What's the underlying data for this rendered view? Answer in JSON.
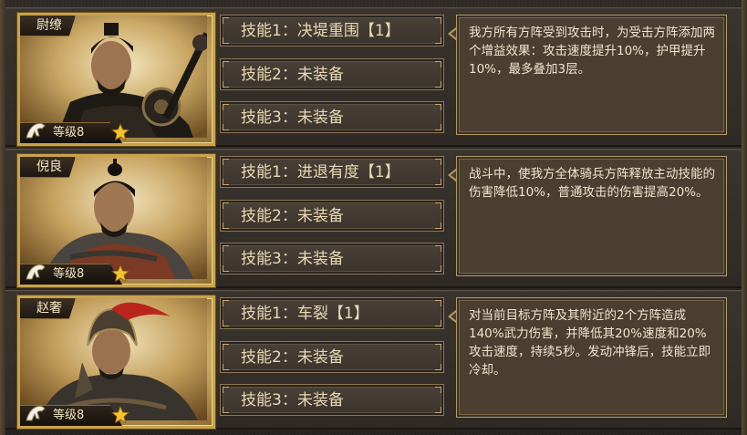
{
  "colors": {
    "gold_frame": "#c9a24a",
    "panel_bg": "#4a3f30",
    "text_light": "#efe6d0"
  },
  "generals": [
    {
      "name": "尉缭",
      "level": "等级8",
      "skills": [
        "技能1：决堤重围【1】",
        "技能2：未装备",
        "技能3：未装备"
      ],
      "description": "我方所有方阵受到攻击时，为受击方阵添加两个增益效果：攻击速度提升10%，护甲提升10%，最多叠加3层。"
    },
    {
      "name": "倪良",
      "level": "等级8",
      "skills": [
        "技能1：进退有度【1】",
        "技能2：未装备",
        "技能3：未装备"
      ],
      "description": "战斗中，使我方全体骑兵方阵释放主动技能的伤害降低10%，普通攻击的伤害提高20%。"
    },
    {
      "name": "赵奢",
      "level": "等级8",
      "skills": [
        "技能1：车裂【1】",
        "技能2：未装备",
        "技能3：未装备"
      ],
      "description": "对当前目标方阵及其附近的2个方阵造成140%武力伤害，并降低其20%速度和20%攻击速度，持续5秒。发动冲锋后，技能立即冷却。"
    }
  ]
}
